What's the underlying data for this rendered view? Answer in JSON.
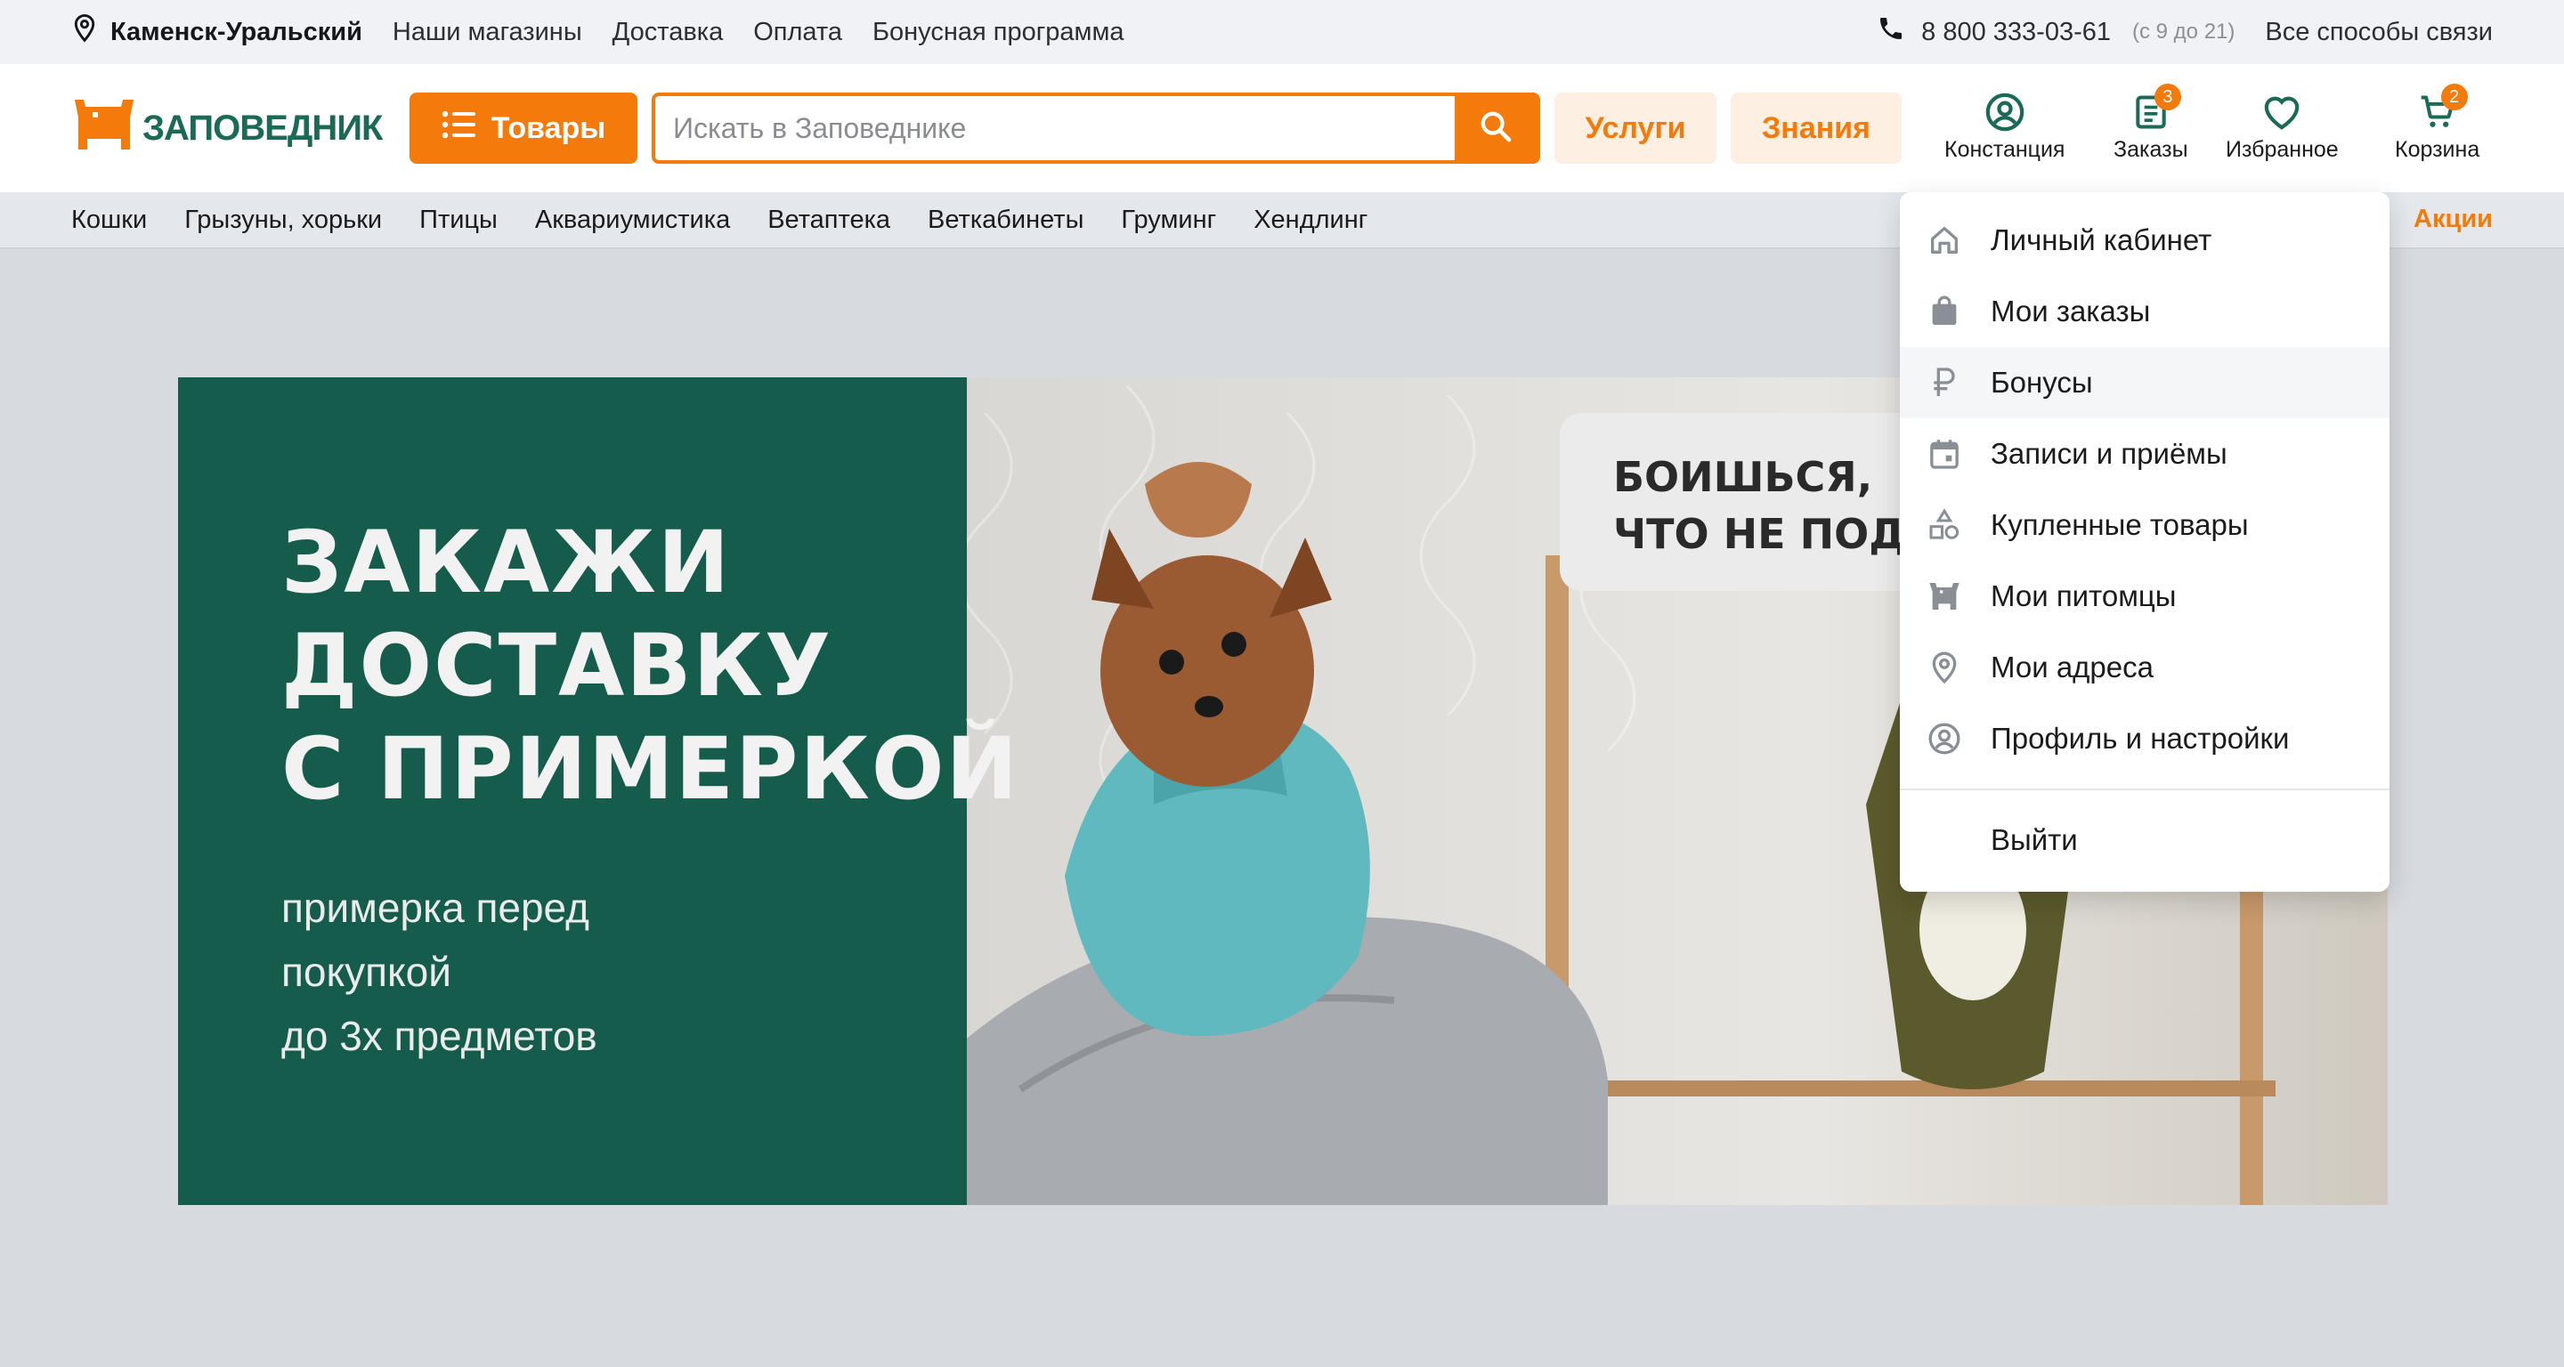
{
  "topbar": {
    "city": "Каменск-Уральский",
    "links": [
      "Наши магазины",
      "Доставка",
      "Оплата",
      "Бонусная программа"
    ],
    "phone": "8 800 333-03-61",
    "hours": "(с 9 до 21)",
    "contacts": "Все способы связи"
  },
  "header": {
    "logo_text": "ЗАПОВЕДНИК",
    "goods_button": "Товары",
    "search_placeholder": "Искать в Заповеднике",
    "services": "Услуги",
    "knowledge": "Знания",
    "icons": {
      "account": {
        "label": "Констанция",
        "icon": "user-circle-icon"
      },
      "orders": {
        "label": "Заказы",
        "icon": "orders-list-icon",
        "badge": "3"
      },
      "favorites": {
        "label": "Избранное",
        "icon": "heart-icon"
      },
      "cart": {
        "label": "Корзина",
        "icon": "cart-icon",
        "badge": "2"
      }
    }
  },
  "categories": [
    "Кошки",
    "Грызуны, хорьки",
    "Птицы",
    "Аквариумистика",
    "Ветаптека",
    "Веткабинеты",
    "Груминг",
    "Хендлинг"
  ],
  "promo_link": "Акции",
  "banner": {
    "title_lines": [
      "ЗАКАЖИ",
      "ДОСТАВКУ",
      "С ПРИМЕРКОЙ"
    ],
    "subtitle_lines": [
      "примерка перед",
      "покупкой",
      "до 3х предметов"
    ],
    "bubble_lines": [
      "БОИШЬСЯ,",
      "ЧТО НЕ ПОДОЙДЁТ"
    ]
  },
  "account_menu": {
    "items": [
      {
        "label": "Личный кабинет",
        "icon": "home-icon"
      },
      {
        "label": "Мои заказы",
        "icon": "shopping-bag-icon"
      },
      {
        "label": "Бонусы",
        "icon": "ruble-icon"
      },
      {
        "label": "Записи и приёмы",
        "icon": "calendar-icon"
      },
      {
        "label": "Купленные товары",
        "icon": "shapes-icon"
      },
      {
        "label": "Мои питомцы",
        "icon": "pet-icon"
      },
      {
        "label": "Мои адреса",
        "icon": "location-pin-icon"
      },
      {
        "label": "Профиль и настройки",
        "icon": "profile-icon"
      }
    ],
    "logout": "Выйти"
  },
  "colors": {
    "accent": "#f47b0b",
    "brand_green": "#1a6a55",
    "banner_green": "#165c4c"
  }
}
